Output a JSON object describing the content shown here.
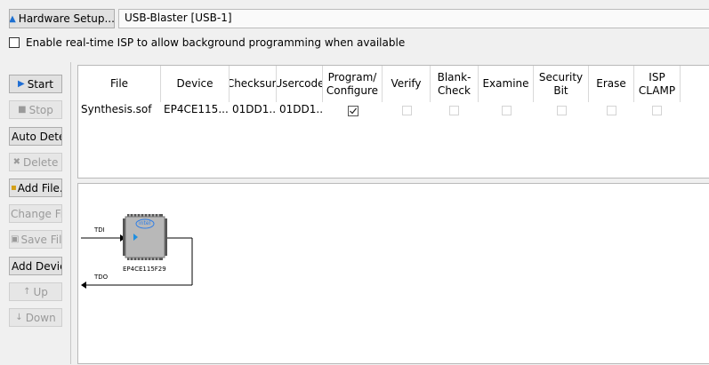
{
  "hardware": {
    "setup_button": "Hardware Setup...",
    "value": "USB-Blaster [USB-1]"
  },
  "isp": {
    "label": "Enable real-time ISP to allow background programming when available",
    "checked": false
  },
  "sidebar": {
    "start": "Start",
    "stop": "Stop",
    "auto_detect": "Auto Dete",
    "delete": "Delete",
    "add_file": "Add File.",
    "change_file": "Change Fil",
    "save_file": "Save File",
    "add_device": "Add Devic",
    "up": "Up",
    "down": "Down"
  },
  "table": {
    "headers": {
      "file": "File",
      "device": "Device",
      "checksum": "Checksun",
      "usercode": "Usercode",
      "program": "Program/ Configure",
      "verify": "Verify",
      "blank_check": "Blank- Check",
      "examine": "Examine",
      "security_bit": "Security Bit",
      "erase": "Erase",
      "isp_clamp": "ISP CLAMP"
    },
    "row": {
      "file": "Synthesis.sof",
      "device": "EP4CE115...",
      "checksum": "01DD1...",
      "usercode": "01DD1...",
      "program_checked": true,
      "verify_checked": false,
      "blank_check_checked": false,
      "examine_checked": false,
      "security_bit_checked": false,
      "erase_checked": false,
      "isp_clamp_checked": false
    }
  },
  "chain": {
    "tdi": "TDI",
    "tdo": "TDO",
    "chip_label": "EP4CE115F29",
    "logo": "intel"
  }
}
